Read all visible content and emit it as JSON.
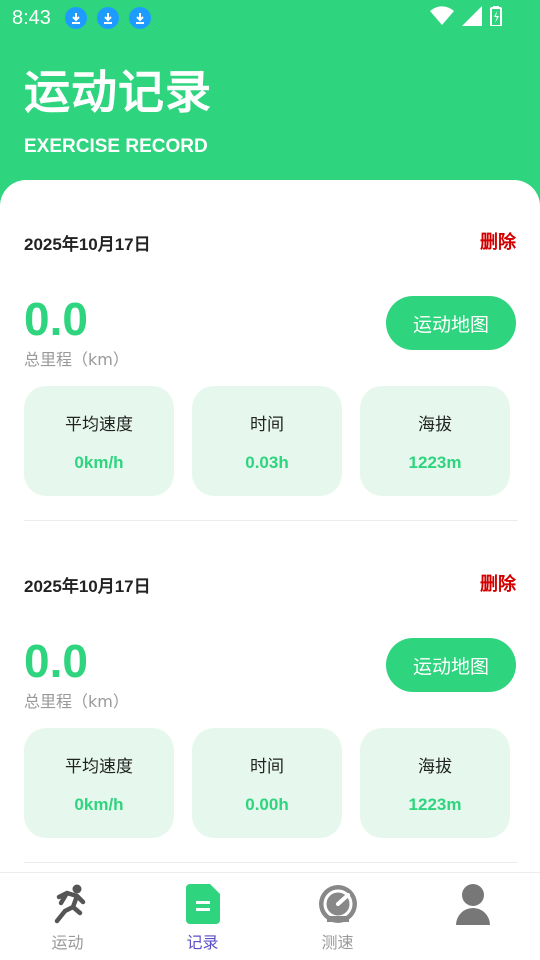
{
  "status_bar": {
    "time": "8:43"
  },
  "header": {
    "title": "运动记录",
    "subtitle": "EXERCISE RECORD"
  },
  "records": [
    {
      "date": "2025年10月17日",
      "delete_label": "删除",
      "distance": "0.0",
      "distance_label": "总里程（km）",
      "map_button": "运动地图",
      "stats": [
        {
          "label": "平均速度",
          "value": "0km/h"
        },
        {
          "label": "时间",
          "value": "0.03h"
        },
        {
          "label": "海拔",
          "value": "1223m"
        }
      ]
    },
    {
      "date": "2025年10月17日",
      "delete_label": "删除",
      "distance": "0.0",
      "distance_label": "总里程（km）",
      "map_button": "运动地图",
      "stats": [
        {
          "label": "平均速度",
          "value": "0km/h"
        },
        {
          "label": "时间",
          "value": "0.00h"
        },
        {
          "label": "海拔",
          "value": "1223m"
        }
      ]
    }
  ],
  "tabbar": {
    "items": [
      {
        "label": "运动",
        "icon": "running-person-icon",
        "active": false
      },
      {
        "label": "记录",
        "icon": "document-icon",
        "active": true
      },
      {
        "label": "测速",
        "icon": "speedometer-icon",
        "active": false
      },
      {
        "label": "",
        "icon": "person-icon",
        "active": false
      }
    ]
  },
  "colors": {
    "brand": "#2ed47e",
    "delete": "#d40000",
    "active_tab": "#5b4fc7",
    "stat_bg": "#e6f8ee"
  }
}
